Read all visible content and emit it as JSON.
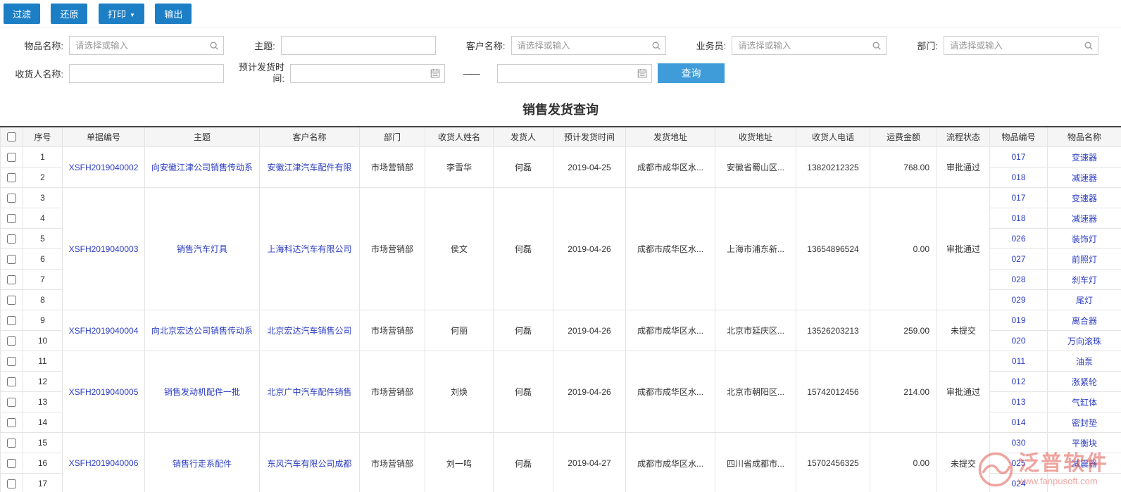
{
  "colors": {
    "accent": "#1c7fc5",
    "query": "#3f9cd9",
    "link": "#2b3cc4",
    "topline": "#444444",
    "header_bg": "#f5f5f5",
    "border": "#e4e4e4",
    "watermark": "#e05a50"
  },
  "icons": {
    "caret_down": "▼",
    "search": "search-icon",
    "calendar": "calendar-icon"
  },
  "toolbar": {
    "filter": "过滤",
    "restore": "还原",
    "print": "打印",
    "export": "输出"
  },
  "filters": {
    "select_placeholder": "请选择或输入",
    "item_name_label": "物品名称:",
    "subject_label": "主题:",
    "customer_label": "客户名称:",
    "salesperson_label": "业务员:",
    "department_label": "部门:",
    "consignee_label": "收货人名称:",
    "ship_time_label": "预计发货时间:",
    "range_separator": "——",
    "query_button": "查询"
  },
  "page_title": "销售发货查询",
  "table": {
    "headers": [
      "序号",
      "单据编号",
      "主题",
      "客户名称",
      "部门",
      "收货人姓名",
      "发货人",
      "预计发货时间",
      "发货地址",
      "收货地址",
      "收货人电话",
      "运费金额",
      "流程状态",
      "物品编号",
      "物品名称"
    ],
    "documents": [
      {
        "doc_no": "XSFH2019040002",
        "subject": "向安徽江津公司销售传动系",
        "customer": "安徽江津汽车配件有限",
        "department": "市场营销部",
        "consignee": "李雪华",
        "shipper": "何磊",
        "ship_date": "2019-04-25",
        "ship_address": "成都市成华区水...",
        "receive_address": "安徽省蜀山区...",
        "phone": "13820212325",
        "freight": "768.00",
        "status": "审批通过",
        "items": [
          {
            "seq": 1,
            "no": "017",
            "name": "变速器"
          },
          {
            "seq": 2,
            "no": "018",
            "name": "减速器"
          }
        ]
      },
      {
        "doc_no": "XSFH2019040003",
        "subject": "销售汽车灯具",
        "customer": "上海科达汽车有限公司",
        "department": "市场营销部",
        "consignee": "侯文",
        "shipper": "何磊",
        "ship_date": "2019-04-26",
        "ship_address": "成都市成华区水...",
        "receive_address": "上海市浦东新...",
        "phone": "13654896524",
        "freight": "0.00",
        "status": "审批通过",
        "items": [
          {
            "seq": 3,
            "no": "017",
            "name": "变速器"
          },
          {
            "seq": 4,
            "no": "018",
            "name": "减速器"
          },
          {
            "seq": 5,
            "no": "026",
            "name": "装饰灯"
          },
          {
            "seq": 6,
            "no": "027",
            "name": "前照灯"
          },
          {
            "seq": 7,
            "no": "028",
            "name": "刹车灯"
          },
          {
            "seq": 8,
            "no": "029",
            "name": "尾灯"
          }
        ]
      },
      {
        "doc_no": "XSFH2019040004",
        "subject": "向北京宏达公司销售传动系",
        "customer": "北京宏达汽车销售公司",
        "department": "市场营销部",
        "consignee": "何丽",
        "shipper": "何磊",
        "ship_date": "2019-04-26",
        "ship_address": "成都市成华区水...",
        "receive_address": "北京市延庆区...",
        "phone": "13526203213",
        "freight": "259.00",
        "status": "未提交",
        "items": [
          {
            "seq": 9,
            "no": "019",
            "name": "离合器"
          },
          {
            "seq": 10,
            "no": "020",
            "name": "万向滚珠"
          }
        ]
      },
      {
        "doc_no": "XSFH2019040005",
        "subject": "销售发动机配件一批",
        "customer": "北京广中汽车配件销售",
        "department": "市场营销部",
        "consignee": "刘焕",
        "shipper": "何磊",
        "ship_date": "2019-04-26",
        "ship_address": "成都市成华区水...",
        "receive_address": "北京市朝阳区...",
        "phone": "15742012456",
        "freight": "214.00",
        "status": "审批通过",
        "items": [
          {
            "seq": 11,
            "no": "011",
            "name": "油泵"
          },
          {
            "seq": 12,
            "no": "012",
            "name": "涨紧轮"
          },
          {
            "seq": 13,
            "no": "013",
            "name": "气缸体"
          },
          {
            "seq": 14,
            "no": "014",
            "name": "密封垫"
          }
        ]
      },
      {
        "doc_no": "XSFH2019040006",
        "subject": "销售行走系配件",
        "customer": "东风汽车有限公司成都",
        "department": "市场营销部",
        "consignee": "刘一鸣",
        "shipper": "何磊",
        "ship_date": "2019-04-27",
        "ship_address": "成都市成华区水...",
        "receive_address": "四川省成都市...",
        "phone": "15702456325",
        "freight": "0.00",
        "status": "未提交",
        "items": [
          {
            "seq": 15,
            "no": "030",
            "name": "平衡块"
          },
          {
            "seq": 16,
            "no": "025",
            "name": "减震器"
          },
          {
            "seq": 17,
            "no": "024",
            "name": ""
          }
        ]
      }
    ]
  },
  "watermark": {
    "brand": "泛普软件",
    "site": "www.fanpusoft.com"
  }
}
